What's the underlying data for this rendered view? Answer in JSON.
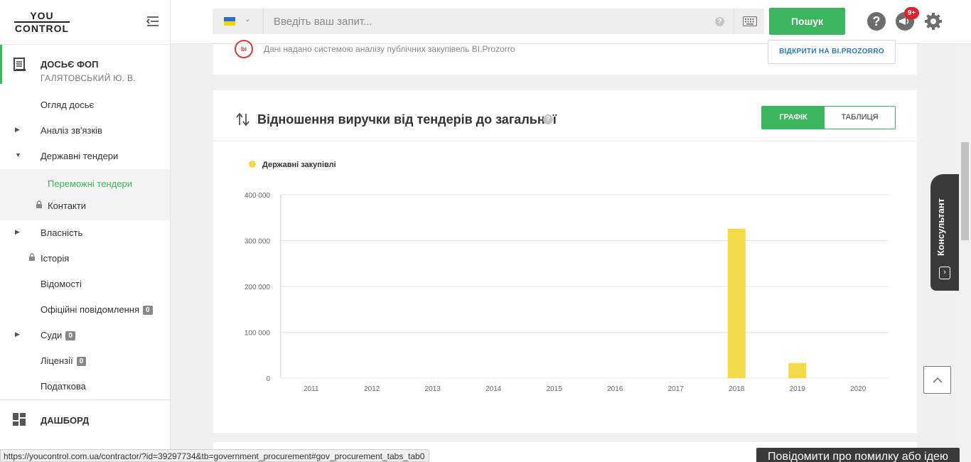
{
  "logo": {
    "line1": "YOU",
    "line2": "CONTROL"
  },
  "dossier": {
    "title": "ДОСЬЄ ФОП",
    "subtitle": "ГАЛЯТОВСЬКИЙ Ю. В."
  },
  "nav": [
    {
      "label": "Огляд досьє"
    },
    {
      "label": "Аналіз зв'язків"
    },
    {
      "label": "Державні тендери"
    },
    {
      "label": "Власність"
    },
    {
      "label": "Історія"
    },
    {
      "label": "Відомості"
    },
    {
      "label": "Офіційні повідомлення",
      "badge": "0"
    },
    {
      "label": "Суди",
      "badge": "0"
    },
    {
      "label": "Ліцензії",
      "badge": "0"
    },
    {
      "label": "Податкова"
    }
  ],
  "subnav": [
    {
      "label": "Переможні тендери"
    },
    {
      "label": "Контакти"
    }
  ],
  "dashboard": {
    "label": "ДАШБОРД"
  },
  "search": {
    "placeholder": "Введіть ваш запит...",
    "help": "?",
    "button": "Пошук"
  },
  "topbar": {
    "help": "?",
    "notif_badge": "9+"
  },
  "colors": {
    "accent": "#3cb65c",
    "bar": "#f2da48",
    "badge": "#e0202c"
  },
  "bi": {
    "logo": "bi",
    "text": "Дані надано системою аналізу публічних закупівель BI.Prozorro",
    "button": "ВІДКРИТИ НА BI.PROZORRO"
  },
  "card": {
    "title": "Відношення виручки від тендерів до загальної",
    "help": "?",
    "toggle_chart": "ГРАФІК",
    "toggle_table": "ТАБЛИЦЯ"
  },
  "chart_data": {
    "type": "bar",
    "categories": [
      "2011",
      "2012",
      "2013",
      "2014",
      "2015",
      "2016",
      "2017",
      "2018",
      "2019",
      "2020"
    ],
    "series": [
      {
        "name": "Державні закупівлі",
        "values": [
          0,
          0,
          0,
          0,
          0,
          0,
          0,
          326000,
          33000,
          0
        ]
      }
    ],
    "yticks": [
      0,
      100000,
      200000,
      300000,
      400000
    ],
    "ytick_labels": [
      "0",
      "100 000",
      "200 000",
      "300 000",
      "400 000"
    ],
    "ylim": [
      0,
      400000
    ],
    "grid": true,
    "legend": "top-left"
  },
  "consultant": {
    "label": "Консультант"
  },
  "status_url": "https://youcontrol.com.ua/contractor/?id=39297734&tb=government_procurement#gov_procurement_tabs_tab0",
  "feedback": "Повідомити про помилку або ідею"
}
